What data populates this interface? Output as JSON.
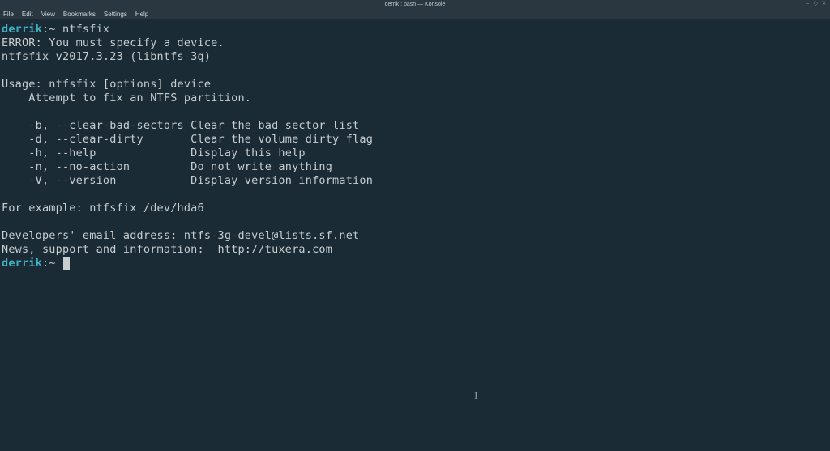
{
  "window": {
    "title": "derrik : bash — Konsole"
  },
  "menu": {
    "file": "File",
    "edit": "Edit",
    "view": "View",
    "bookmarks": "Bookmarks",
    "settings": "Settings",
    "help": "Help"
  },
  "winbtn": {
    "min": "⎯",
    "max": "◇",
    "close": "✕"
  },
  "term": {
    "user": "derrik",
    "sep": ":",
    "tilde": "~",
    "cmd1": "ntfsfix",
    "l1": "ERROR: You must specify a device.",
    "l2": "ntfsfix v2017.3.23 (libntfs-3g)",
    "l3": "",
    "l4": "Usage: ntfsfix [options] device",
    "l5": "    Attempt to fix an NTFS partition.",
    "l6": "",
    "l7": "    -b, --clear-bad-sectors Clear the bad sector list",
    "l8": "    -d, --clear-dirty       Clear the volume dirty flag",
    "l9": "    -h, --help              Display this help",
    "l10": "    -n, --no-action         Do not write anything",
    "l11": "    -V, --version           Display version information",
    "l12": "",
    "l13": "For example: ntfsfix /dev/hda6",
    "l14": "",
    "l15": "Developers' email address: ntfs-3g-devel@lists.sf.net",
    "l16": "News, support and information:  http://tuxera.com"
  }
}
